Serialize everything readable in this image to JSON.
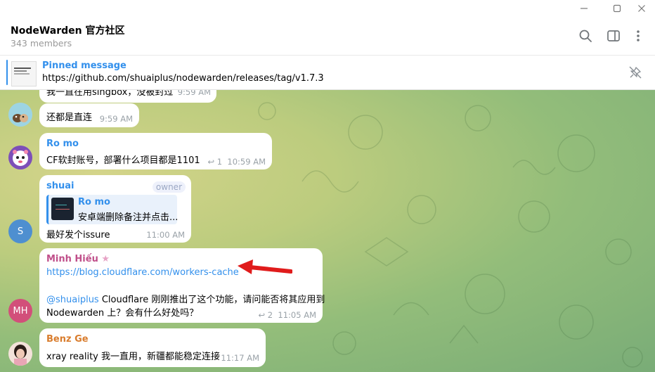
{
  "window": {
    "minimize": "—",
    "maximize": "☐",
    "close": "✕"
  },
  "header": {
    "title": "NodeWarden 官方社区",
    "subtitle": "343 members"
  },
  "pinned": {
    "label": "Pinned message",
    "text": "https://github.com/shuaiplus/nodewarden/releases/tag/v1.7.3"
  },
  "messages": [
    {
      "id": "m0",
      "text": "我一直在用singbox，没被封过",
      "time": "9:59 AM"
    },
    {
      "id": "m1",
      "text": "还都是直连",
      "time": "9:59 AM"
    },
    {
      "id": "m2",
      "sender": "Ro mo",
      "text": "CF软封账号，部署什么项目都是1101",
      "replies": "1",
      "time": "10:59 AM"
    },
    {
      "id": "m3",
      "sender": "shuai",
      "badge": "owner",
      "reply_sender": "Ro mo",
      "reply_text": "安卓端删除备注并点击...",
      "text": "最好发个issure",
      "time": "11:00 AM",
      "avatar_letter": "S"
    },
    {
      "id": "m4",
      "sender": "Minh Hiếu",
      "link": "https://blog.cloudflare.com/workers-cache",
      "mention": "@shuaiplus",
      "text1": " Cloudflare 刚刚推出了这个功能，请问能否将其应用到",
      "text2": "Nodewarden 上？会有什么好处吗？",
      "replies": "2",
      "time": "11:05 AM",
      "avatar_letter": "MH"
    },
    {
      "id": "m5",
      "sender": "Benz Ge",
      "text": "xray reality 我一直用，新疆都能稳定连接",
      "time": "11:17 AM"
    }
  ],
  "colors": {
    "accent": "#3390ec",
    "ro_mo": "#3390ec",
    "shuai": "#3390ec",
    "minh": "#c04f8a",
    "benz": "#d97d2e",
    "arrow": "#e01b1b"
  }
}
